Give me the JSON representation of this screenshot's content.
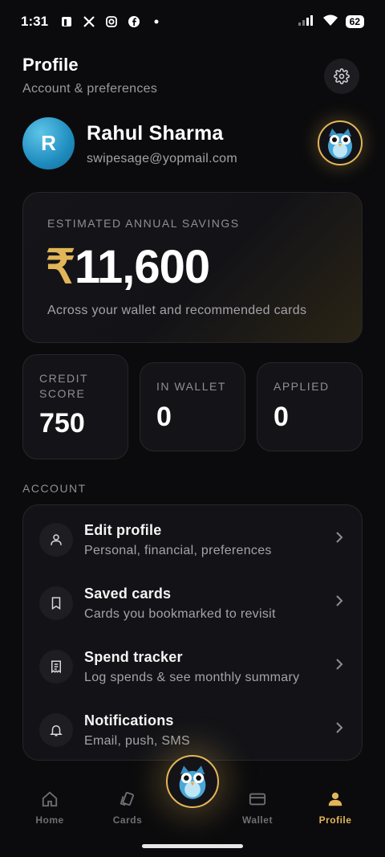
{
  "status_bar": {
    "time": "1:31",
    "battery": "62",
    "icons": [
      "notification-app-icon",
      "x-icon",
      "instagram-icon",
      "facebook-icon",
      "dot-icon",
      "signal-icon",
      "wifi-icon",
      "battery-icon"
    ]
  },
  "header": {
    "title": "Profile",
    "subtitle": "Account & preferences",
    "settings_icon": "gear-icon"
  },
  "user": {
    "initial": "R",
    "name": "Rahul Sharma",
    "email": "swipesage@yopmail.com",
    "mascot_icon": "owl-icon"
  },
  "savings": {
    "label": "ESTIMATED ANNUAL SAVINGS",
    "currency": "₹",
    "amount": "11,600",
    "note": "Across your wallet and recommended cards"
  },
  "stats": {
    "credit_score": {
      "label": "CREDIT SCORE",
      "value": "750"
    },
    "in_wallet": {
      "label": "IN WALLET",
      "value": "0"
    },
    "applied": {
      "label": "APPLIED",
      "value": "0"
    }
  },
  "account": {
    "section_label": "ACCOUNT",
    "items": [
      {
        "title": "Edit profile",
        "subtitle": "Personal, financial, preferences",
        "icon": "user-icon"
      },
      {
        "title": "Saved cards",
        "subtitle": "Cards you bookmarked to revisit",
        "icon": "bookmark-icon"
      },
      {
        "title": "Spend tracker",
        "subtitle": "Log spends & see monthly summary",
        "icon": "receipt-icon"
      },
      {
        "title": "Notifications",
        "subtitle": "Email, push, SMS",
        "icon": "bell-icon"
      }
    ]
  },
  "bottom_nav": {
    "items": [
      {
        "label": "Home",
        "icon": "home-icon"
      },
      {
        "label": "Cards",
        "icon": "cards-icon"
      },
      {
        "label": "Wallet",
        "icon": "wallet-icon"
      },
      {
        "label": "Profile",
        "icon": "profile-icon"
      }
    ],
    "active": "Profile"
  },
  "colors": {
    "background": "#0b0b0d",
    "accent": "#e2b658",
    "avatar": "#1f8dbf",
    "card": "#141418"
  }
}
